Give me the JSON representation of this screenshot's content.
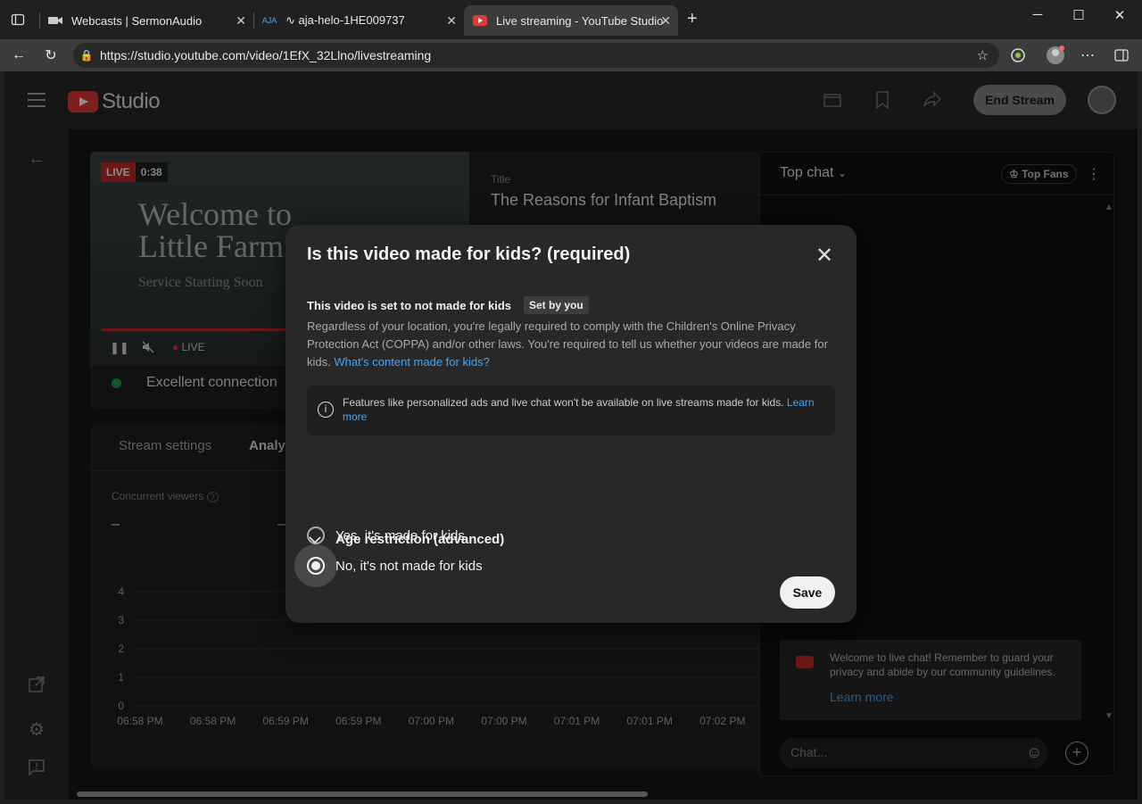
{
  "browser": {
    "tabs": [
      {
        "label": "Webcasts | SermonAudio",
        "active": false
      },
      {
        "label": "∿ aja-helo-1HE009737",
        "active": false
      },
      {
        "label": "Live streaming - YouTube Studio",
        "active": true
      }
    ],
    "url": "https://studio.youtube.com/video/1EfX_32Llno/livestreaming"
  },
  "header": {
    "logo_text": "Studio",
    "end_stream_label": "End Stream"
  },
  "preview": {
    "live_label": "LIVE",
    "live_time": "0:38",
    "welcome_line1": "Welcome to",
    "welcome_line2": "Little Farm",
    "service_text": "Service Starting Soon",
    "live_indicator": "LIVE",
    "connection_text": "Excellent connection",
    "title_label": "Title",
    "title_value": "The Reasons for Infant Baptism"
  },
  "analytics": {
    "tabs": [
      {
        "label": "Stream settings",
        "active": false
      },
      {
        "label": "Analyt",
        "active": true
      }
    ],
    "concurrent_label": "Concurrent viewers",
    "concurrent_value": "–",
    "second_value": "–"
  },
  "chart_data": {
    "type": "line",
    "title": "",
    "xlabel": "",
    "ylabel": "",
    "ylim": [
      0,
      4
    ],
    "y_ticks": [
      "4",
      "3",
      "2",
      "1",
      "0"
    ],
    "categories": [
      "06:58 PM",
      "06:58 PM",
      "06:59 PM",
      "06:59 PM",
      "07:00 PM",
      "07:00 PM",
      "07:01 PM",
      "07:01 PM",
      "07:02 PM"
    ],
    "series": [],
    "grid": true
  },
  "chat": {
    "title": "Top chat",
    "top_fans_label": "Top Fans",
    "welcome_text": "Welcome to live chat! Remember to guard your privacy and abide by our community guidelines.",
    "learn_more": "Learn more",
    "input_placeholder": "Chat..."
  },
  "modal": {
    "title": "Is this video made for kids? (required)",
    "status_text": "This video is set to not made for kids",
    "status_chip": "Set by you",
    "description": "Regardless of your location, you're legally required to comply with the Children's Online Privacy Protection Act (COPPA) and/or other laws. You're required to tell us whether your videos are made for kids.",
    "description_link": "What's content made for kids?",
    "info_text": "Features like personalized ads and live chat won't be available on live streams made for kids.",
    "info_link": "Learn more",
    "option_yes": "Yes, it's made for kids",
    "option_no": "No, it's not made for kids",
    "selected": "no",
    "age_restriction": "Age restriction (advanced)",
    "save_label": "Save"
  }
}
